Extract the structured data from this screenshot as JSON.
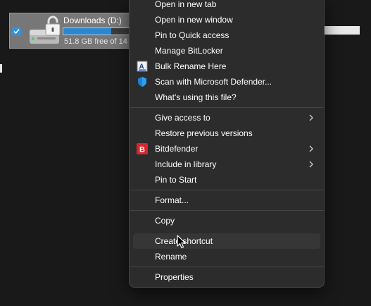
{
  "drive": {
    "name": "Downloads (D:)",
    "free_text": "51.8 GB free of 14",
    "used_fraction": 0.63,
    "selected": true
  },
  "context_menu": {
    "items": [
      {
        "label": "Open in new tab",
        "icon": null,
        "submenu": false
      },
      {
        "label": "Open in new window",
        "icon": null,
        "submenu": false
      },
      {
        "label": "Pin to Quick access",
        "icon": null,
        "submenu": false
      },
      {
        "label": "Manage BitLocker",
        "icon": null,
        "submenu": false
      },
      {
        "label": "Bulk Rename Here",
        "icon": "bulk-rename-icon",
        "submenu": false
      },
      {
        "label": "Scan with Microsoft Defender...",
        "icon": "defender-shield-icon",
        "submenu": false
      },
      {
        "label": "What's using this file?",
        "icon": null,
        "submenu": false
      },
      {
        "label": "Give access to",
        "icon": null,
        "submenu": true
      },
      {
        "label": "Restore previous versions",
        "icon": null,
        "submenu": false
      },
      {
        "label": "Bitdefender",
        "icon": "bitdefender-icon",
        "submenu": true
      },
      {
        "label": "Include in library",
        "icon": null,
        "submenu": true
      },
      {
        "label": "Pin to Start",
        "icon": null,
        "submenu": false
      },
      {
        "label": "Format...",
        "icon": null,
        "submenu": false
      },
      {
        "label": "Copy",
        "icon": null,
        "submenu": false
      },
      {
        "label": "Create shortcut",
        "icon": null,
        "submenu": false,
        "hovered": true
      },
      {
        "label": "Rename",
        "icon": null,
        "submenu": false
      },
      {
        "label": "Properties",
        "icon": null,
        "submenu": false
      }
    ]
  },
  "colors": {
    "menu_bg": "#2c2c2c",
    "hover_bg": "#363636",
    "separator": "#444444",
    "accent": "#2e86cf",
    "bitdefender_red": "#d7262e",
    "defender_blue": "#1f7fd6"
  }
}
